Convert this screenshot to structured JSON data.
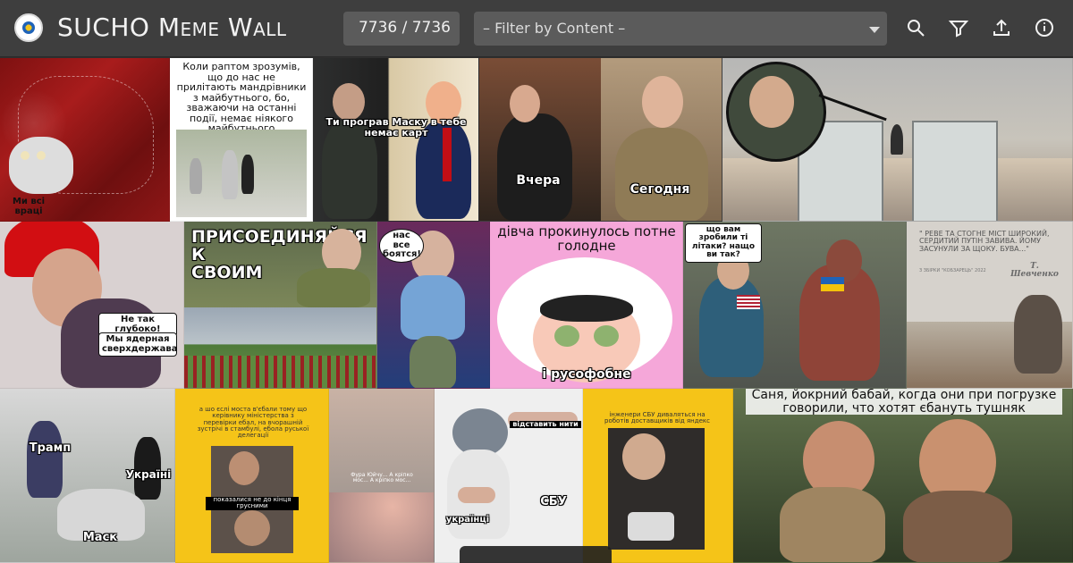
{
  "app": {
    "title": "SUCHO Meme Wall",
    "counter": "7736 / 7736",
    "filter_placeholder": "– Filter by Content –"
  },
  "toolbar": {
    "icons": [
      "search-icon",
      "filter-icon",
      "upload-icon",
      "info-icon"
    ]
  },
  "memes": {
    "t1_caption": "Ми всі враці",
    "t2_caption": "Коли раптом зрозумів, що до нас не прилітають мандрівники з майбутнього, бо, зважаючи на останні події, немає ніякого майбутнього",
    "t3_caption": "Ти програв Маску в тебе немає карт",
    "t4_left": "Вчера",
    "t4_right": "Сегодня",
    "t6_bubble_1": "Не так глубоко!",
    "t6_bubble_2": "Мы ядерная сверхдержава",
    "t7_caption": "ПРИСОЕДИНЯЙСЯ К СВОИМ",
    "t8_bubble": "нас все боятся!",
    "t9_top": "дівча прокинулось потне голодне",
    "t9_bottom": "і русофобне",
    "t10_bubble": "що вам зробили ті літаки? нащо ви так?",
    "t11_quote": "\" РЕВЕ ТА СТОГНЕ МІСТ ШИРОКИЙ, СЕРДИТИЙ ПУТІН ЗАВИВА. ЙОМУ ЗАСУНУЛИ ЗА ЩОКУ. БУВА...\"",
    "t11_source": "З ЗБІРКИ \"КОБЗАРЕЦЬ\" 2022",
    "t11_sign": "Т. Шевченко",
    "t12_label_1": "Трамп",
    "t12_label_2": "Україні",
    "t12_label_3": "Маск",
    "t13_text": "а шо єслі моста в'єбали тому що керівнику міністерства з перевірки ебал, на вчорашній зустрічі в стамбулі, ебола руської делегації",
    "t13_bottom": "показалися не до кінця грусними",
    "t14_text": "Фура Юйчу... A кріпко мос... A кріпко мос...",
    "t15_tag": "відставить нити",
    "t15_left": "українці",
    "t15_right": "СБУ",
    "t16_text": "інженери СБУ диваляться на роботів доставщиків від яндекс",
    "t17_caption": "Саня, йокрний бабай, когда они при погрузке говорили, что хотят єбануть тушняк"
  }
}
